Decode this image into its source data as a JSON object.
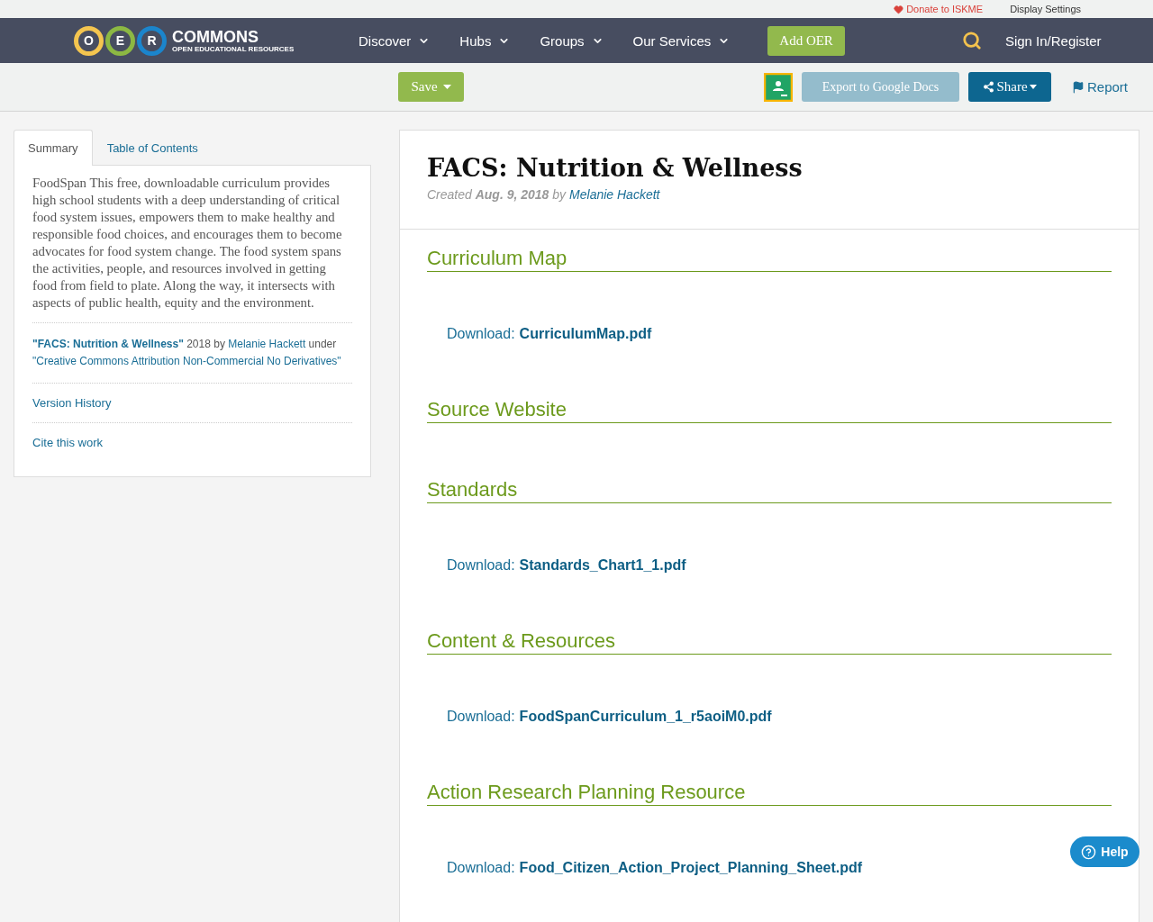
{
  "top_bar": {
    "donate": "Donate to ISKME",
    "display_settings": "Display Settings"
  },
  "logo": {
    "letters": [
      "O",
      "E",
      "R"
    ],
    "name": "COMMONS",
    "tagline": "OPEN EDUCATIONAL RESOURCES"
  },
  "nav": {
    "items": [
      {
        "label": "Discover"
      },
      {
        "label": "Hubs"
      },
      {
        "label": "Groups"
      },
      {
        "label": "Our Services"
      }
    ],
    "add_button": "Add OER",
    "sign_in": "Sign In/Register"
  },
  "toolbar": {
    "save": "Save",
    "export": "Export to Google Docs",
    "share": "Share",
    "report": "Report"
  },
  "tabs": [
    {
      "label": "Summary",
      "selected": true
    },
    {
      "label": "Table of Contents",
      "selected": false
    }
  ],
  "summary": {
    "description": "FoodSpan This free, downloadable curriculum provides high school students with a deep understanding of critical food system issues, empowers them to make healthy and responsible food choices, and encourages them to become advocates for food system change. The food system spans the activities, people, and resources involved in getting food from field to plate. Along the way, it intersects with aspects of public health, equity and the environment.",
    "attribution": {
      "title": "\"FACS: Nutrition & Wellness\"",
      "year_by": "2018 by",
      "author": "Melanie Hackett",
      "under": "under",
      "license": "\"Creative Commons Attribution Non-Commercial No Derivatives\""
    },
    "links": [
      "Version History",
      "Cite this work"
    ]
  },
  "resource": {
    "title": "FACS: Nutrition & Wellness",
    "created": "Created **Aug. 9, 2018** by",
    "author": "Melanie Hackett",
    "sections": [
      {
        "heading": "Curriculum Map",
        "download": {
          "label": "Download:",
          "file": "CurriculumMap.pdf"
        }
      },
      {
        "heading": "Source Website"
      },
      {
        "heading": "Standards",
        "download": {
          "label": "Download:",
          "file": "Standards_Chart1_1.pdf"
        }
      },
      {
        "heading": "Content & Resources",
        "download": {
          "label": "Download:",
          "file": "FoodSpanCurriculum_1_r5aoiM0.pdf"
        }
      },
      {
        "heading": "Action Research Planning Resource",
        "download": {
          "label": "Download:",
          "file": "Food_Citizen_Action_Project_Planning_Sheet.pdf"
        }
      }
    ]
  },
  "help": "Help"
}
